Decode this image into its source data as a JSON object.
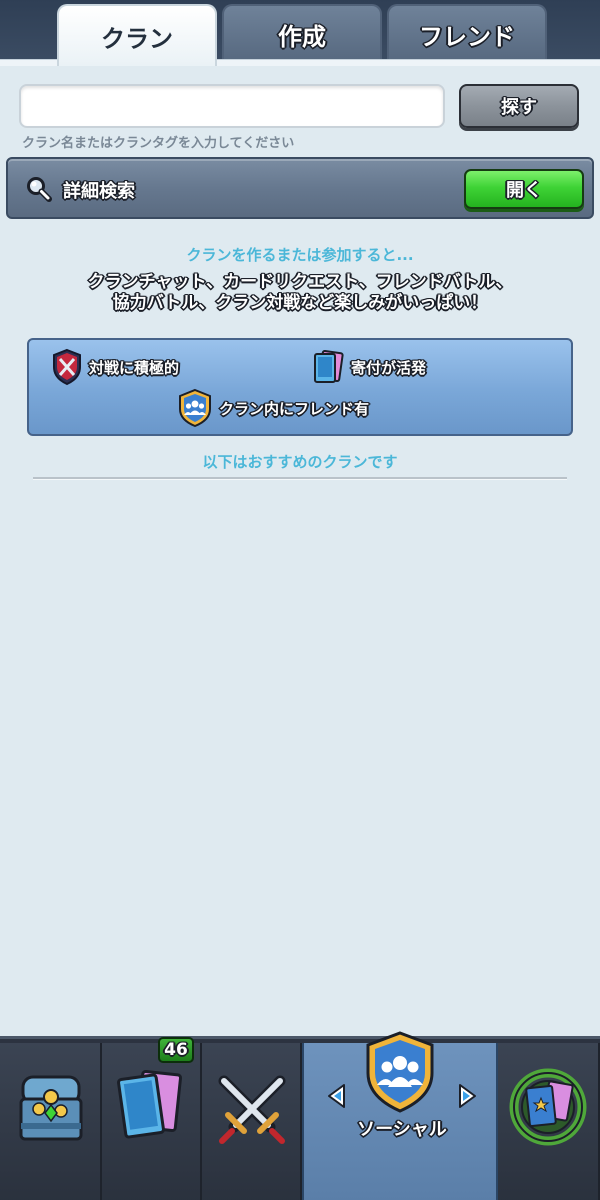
{
  "tabs": {
    "clan": "クラン",
    "create": "作成",
    "friend": "フレンド"
  },
  "search": {
    "value": "",
    "placeholder": "",
    "hint": "クラン名またはクランタグを入力してください",
    "button_label": "探す"
  },
  "advanced_search": {
    "label": "詳細検索",
    "open_label": "開く"
  },
  "info": {
    "lead": "クランを作るまたは参加すると...",
    "body_line1": "クランチャット、カードリクエスト、フレンドバトル、",
    "body_line2": "協力バトル、クラン対戦など楽しみがいっぱい！",
    "features": {
      "battle": "対戦に積極的",
      "donate": "寄付が活発",
      "friends": "クラン内にフレンド有"
    },
    "recommend": "以下はおすすめのクランです"
  },
  "bottom_nav": {
    "cards_badge": "46",
    "social_label": "ソーシャル",
    "icons": [
      "chest-icon",
      "cards-icon",
      "crossed-swords-icon",
      "social-shield-icon",
      "laurel-cards-icon"
    ]
  },
  "colors": {
    "accent_blue": "#4bb7d8",
    "green_button": "#3fd336",
    "active_tab_bg": "#ffffff",
    "nav_active": "#6e93bd"
  }
}
